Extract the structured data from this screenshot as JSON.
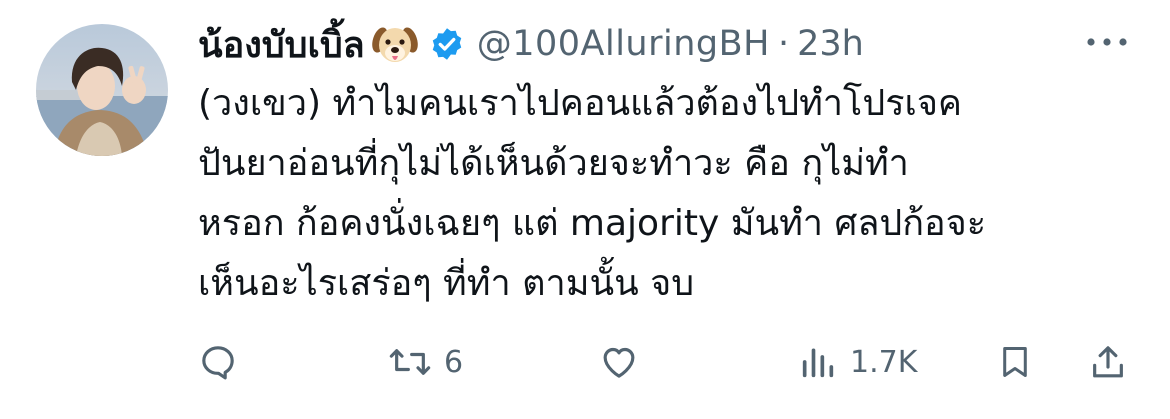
{
  "tweet": {
    "display_name": "น้องบับเบิ้ล",
    "name_emoji_icon": "dog-face-icon",
    "verified_icon": "verified-badge-icon",
    "handle": "@100AlluringBH",
    "separator": "·",
    "time": "23h",
    "more_icon": "more-horizontal-icon",
    "text": "(วงเขว) ทำไมคนเราไปคอนแล้วต้องไปทำโปรเจค\nปันยาอ่อนที่กุไม่ได้เห็นด้วยจะทำวะ คือ กุไม่ทำ\nหรอก ก้อคงนั่งเฉยๆ แต่ majority มันทำ ศลปก้อจะ\nเห็นอะไรเสร่อๆ ที่ทำ ตามนั้น จบ"
  },
  "actions": {
    "reply": {
      "icon": "reply-icon",
      "count": ""
    },
    "retweet": {
      "icon": "retweet-icon",
      "count": "6"
    },
    "like": {
      "icon": "heart-icon",
      "count": ""
    },
    "views": {
      "icon": "views-chart-icon",
      "count": "1.7K"
    },
    "bookmark": {
      "icon": "bookmark-icon"
    },
    "share": {
      "icon": "share-icon"
    }
  },
  "colors": {
    "text": "#0f1419",
    "secondary": "#536471",
    "verified": "#1d9bf0"
  }
}
